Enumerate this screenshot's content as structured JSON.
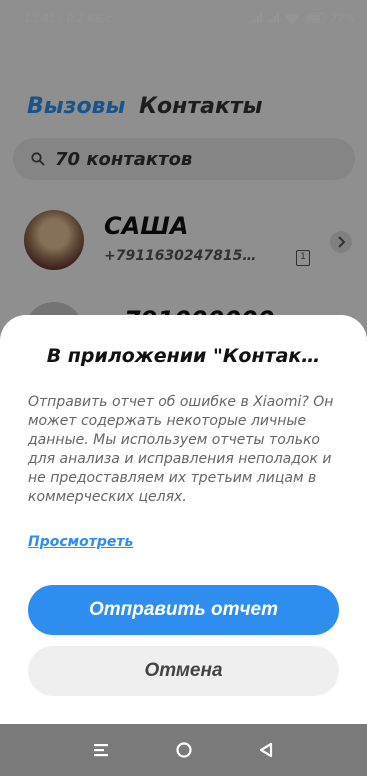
{
  "status": {
    "time": "13:41",
    "speed": "0,2 КБ/с",
    "battery": "77"
  },
  "tabs": [
    {
      "label": "Вызовы"
    },
    {
      "label": "Контакты"
    }
  ],
  "search": {
    "text": "70 контактов"
  },
  "contact": {
    "name": "САША",
    "phone": "+7911630247815…",
    "sim": "1"
  },
  "contact2": {
    "name": "791000000"
  },
  "dialog": {
    "title": "В приложении \"Контак…",
    "message": "Отправить отчет об ошибке в Xiaomi? Он может содержать некоторые личные данные. Мы используем отчеты только для анализа и исправления неполадок и не предоставляем их третьим лицам в коммерческих целях.",
    "link": "Просмотреть",
    "send": "Отправить отчет",
    "cancel": "Отмена"
  },
  "colors": {
    "accent": "#2e8ef0",
    "nav": "#7a7a7a"
  },
  "icons": [
    "search-icon",
    "chevron-right-icon",
    "sim-icon",
    "menu-icon",
    "home-icon",
    "back-icon",
    "wifi-icon",
    "battery-icon",
    "signal-icon"
  ]
}
